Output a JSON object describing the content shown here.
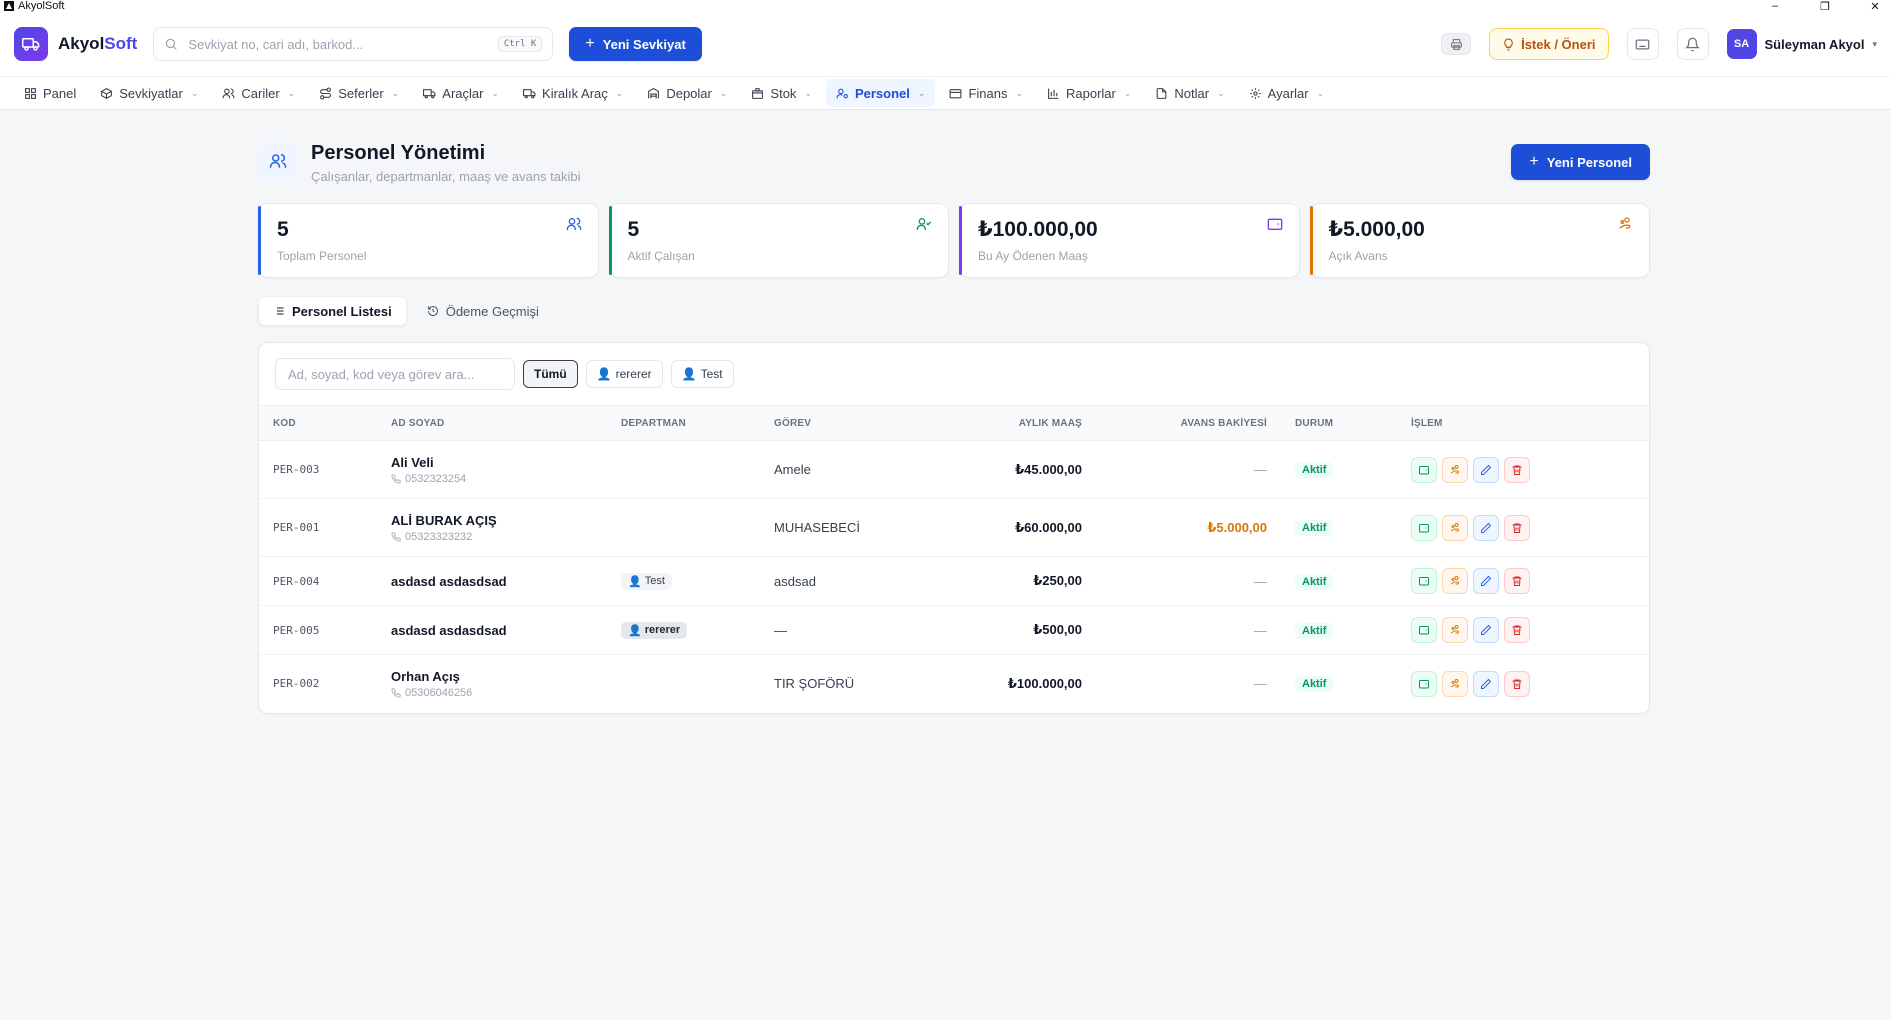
{
  "window": {
    "title": "AkyolSoft",
    "controls": [
      "–",
      "❐",
      "✕"
    ]
  },
  "header": {
    "brand_prefix": "Akyol",
    "brand_suffix": "Soft",
    "search_placeholder": "Sevkiyat no, cari adı, barkod...",
    "search_shortcut": "Ctrl K",
    "new_shipment_label": "Yeni Sevkiyat",
    "suggestion_label": "İstek / Öneri",
    "user_initials": "SA",
    "user_name": "Süleyman Akyol"
  },
  "nav": {
    "items": [
      {
        "label": "Panel",
        "icon": "grid-icon",
        "has_dropdown": false
      },
      {
        "label": "Sevkiyatlar",
        "icon": "box-icon",
        "has_dropdown": true
      },
      {
        "label": "Cariler",
        "icon": "users-icon",
        "has_dropdown": true
      },
      {
        "label": "Seferler",
        "icon": "route-icon",
        "has_dropdown": true
      },
      {
        "label": "Araçlar",
        "icon": "truck-icon",
        "has_dropdown": true
      },
      {
        "label": "Kiralık Araç",
        "icon": "truck-icon",
        "has_dropdown": true
      },
      {
        "label": "Depolar",
        "icon": "warehouse-icon",
        "has_dropdown": true
      },
      {
        "label": "Stok",
        "icon": "package-icon",
        "has_dropdown": true
      },
      {
        "label": "Personel",
        "icon": "user-cog-icon",
        "has_dropdown": true,
        "active": true
      },
      {
        "label": "Finans",
        "icon": "wallet-icon",
        "has_dropdown": true
      },
      {
        "label": "Raporlar",
        "icon": "bar-chart-icon",
        "has_dropdown": true
      },
      {
        "label": "Notlar",
        "icon": "file-icon",
        "has_dropdown": true
      },
      {
        "label": "Ayarlar",
        "icon": "gear-icon",
        "has_dropdown": true
      }
    ]
  },
  "page": {
    "title": "Personel Yönetimi",
    "subtitle": "Çalışanlar, departmanlar, maaş ve avans takibi",
    "new_button_label": "Yeni Personel"
  },
  "stats": [
    {
      "value": "5",
      "label": "Toplam Personel",
      "color": "#2563eb",
      "icon": "users-icon"
    },
    {
      "value": "5",
      "label": "Aktif Çalışan",
      "color": "#059669",
      "icon": "user-check-icon"
    },
    {
      "value": "₺100.000,00",
      "label": "Bu Ay Ödenen Maaş",
      "color": "#7c3aed",
      "icon": "wallet-icon"
    },
    {
      "value": "₺5.000,00",
      "label": "Açık Avans",
      "color": "#d97706",
      "icon": "hand-coins-icon"
    }
  ],
  "tabs": [
    {
      "label": "Personel Listesi",
      "icon": "list-icon",
      "active": true
    },
    {
      "label": "Ödeme Geçmişi",
      "icon": "history-icon",
      "active": false
    }
  ],
  "filters": {
    "search_placeholder": "Ad, soyad, kod veya görev ara...",
    "chips": [
      {
        "label": "Tümü",
        "active": true,
        "icon": false
      },
      {
        "label": "rererer",
        "active": false,
        "icon": true
      },
      {
        "label": "Test",
        "active": false,
        "icon": true
      }
    ]
  },
  "table": {
    "columns": [
      "KOD",
      "AD SOYAD",
      "DEPARTMAN",
      "GÖREV",
      "AYLIK MAAŞ",
      "AVANS BAKİYESİ",
      "DURUM",
      "İŞLEM"
    ],
    "rows": [
      {
        "code": "PER-003",
        "name": "Ali Veli",
        "phone": "0532323254",
        "department": "",
        "role": "Amele",
        "salary": "₺45.000,00",
        "advance": "—",
        "advance_highlight": false,
        "status": "Aktif"
      },
      {
        "code": "PER-001",
        "name": "ALİ BURAK AÇIŞ",
        "phone": "05323323232",
        "department": "",
        "role": "MUHASEBECİ",
        "salary": "₺60.000,00",
        "advance": "₺5.000,00",
        "advance_highlight": true,
        "status": "Aktif"
      },
      {
        "code": "PER-004",
        "name": "asdasd asdasdsad",
        "phone": "",
        "department": "Test",
        "department_style": "light",
        "role": "asdsad",
        "salary": "₺250,00",
        "advance": "—",
        "advance_highlight": false,
        "status": "Aktif"
      },
      {
        "code": "PER-005",
        "name": "asdasd asdasdsad",
        "phone": "",
        "department": "rererer",
        "department_style": "dark",
        "role": "—",
        "salary": "₺500,00",
        "advance": "—",
        "advance_highlight": false,
        "status": "Aktif"
      },
      {
        "code": "PER-002",
        "name": "Orhan Açış",
        "phone": "05306046256",
        "department": "",
        "role": "TIR ŞOFÖRÜ",
        "salary": "₺100.000,00",
        "advance": "—",
        "advance_highlight": false,
        "status": "Aktif"
      }
    ]
  }
}
